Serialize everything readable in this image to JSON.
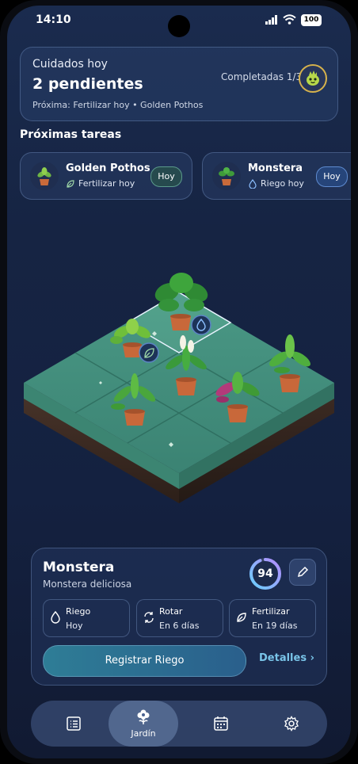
{
  "status_bar": {
    "time": "14:10",
    "battery": "100"
  },
  "summary": {
    "label": "Cuidados hoy",
    "pending": "2 pendientes",
    "completed": "Completadas 1/3",
    "next": "Próxima: Fertilizar hoy • Golden Pothos"
  },
  "upcoming": {
    "title": "Próximas tareas",
    "tasks": [
      {
        "plant": "Golden Pothos",
        "action": "Fertilizar hoy",
        "badge": "Hoy",
        "icon": "leaf-icon"
      },
      {
        "plant": "Monstera",
        "action": "Riego hoy",
        "badge": "Hoy",
        "icon": "water-drop-icon"
      }
    ]
  },
  "detail": {
    "name": "Monstera",
    "scientific": "Monstera deliciosa",
    "health_score": "94",
    "health_fraction": 0.94,
    "schedule": [
      {
        "label": "Riego",
        "when": "Hoy",
        "icon": "water-drop-icon"
      },
      {
        "label": "Rotar",
        "when": "En 6 días",
        "icon": "rotate-icon"
      },
      {
        "label": "Fertilizar",
        "when": "En 19 días",
        "icon": "leaf-icon"
      }
    ],
    "primary_button": "Registrar Riego",
    "secondary_link": "Detalles ›"
  },
  "nav": {
    "items": [
      {
        "name": "list",
        "icon": "list-icon"
      },
      {
        "name": "garden",
        "icon": "flower-icon",
        "label": "Jardín",
        "selected": true
      },
      {
        "name": "calendar",
        "icon": "calendar-icon"
      },
      {
        "name": "settings",
        "icon": "gear-icon"
      }
    ]
  },
  "colors": {
    "accent": "#79c4e8",
    "ground": "#3f8a78",
    "soil": "#3b2a22"
  }
}
